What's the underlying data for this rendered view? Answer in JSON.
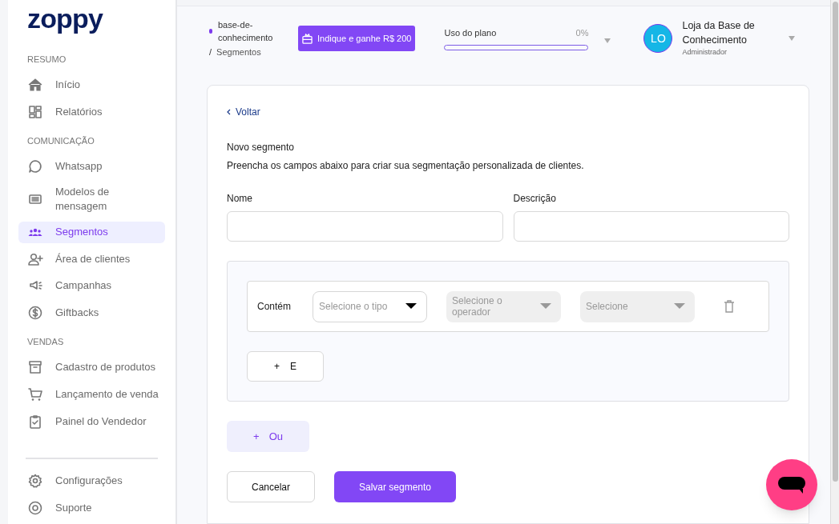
{
  "logo": "zoppy",
  "sidebar": {
    "sections": [
      {
        "title": "RESUMO",
        "items": [
          {
            "label": "Início",
            "kind": "home",
            "selected": false
          },
          {
            "label": "Relatórios",
            "kind": "grid",
            "selected": false
          }
        ]
      },
      {
        "title": "COMUNICAÇÃO",
        "items": [
          {
            "label": "Whatsapp",
            "kind": "chat",
            "selected": false
          },
          {
            "label": "Modelos de mensagem",
            "kind": "list",
            "selected": false
          },
          {
            "label": "Segmentos",
            "kind": "people",
            "selected": true
          },
          {
            "label": "Área de clientes",
            "kind": "user-plus",
            "selected": false
          },
          {
            "label": "Campanhas",
            "kind": "megaphone",
            "selected": false
          },
          {
            "label": "Giftbacks",
            "kind": "dollar",
            "selected": false
          }
        ]
      },
      {
        "title": "VENDAS",
        "items": [
          {
            "label": "Cadastro de produtos",
            "kind": "archive",
            "selected": false
          },
          {
            "label": "Lançamento de venda",
            "kind": "cart",
            "selected": false
          },
          {
            "label": "Painel do Vendedor",
            "kind": "clipboard",
            "selected": false
          }
        ]
      }
    ],
    "footer_items": [
      {
        "label": "Configurações",
        "kind": "gear",
        "selected": false
      },
      {
        "label": "Suporte",
        "kind": "help",
        "selected": false
      }
    ]
  },
  "header": {
    "breadcrumb": [
      "base-de-conhecimento",
      "Segmentos"
    ],
    "breadcrumb_separator": "/",
    "referral_button": "Indique e ganhe R$ 200",
    "plan": {
      "label": "Uso do plano",
      "reading": "0%",
      "level": 0
    },
    "user": {
      "initials": "LO",
      "name": "Loja da Base de Conhecimento",
      "role": "Administrador"
    }
  },
  "form": {
    "back": "Voltar",
    "title": "Novo segmento",
    "description": "Preencha os campos abaixo para criar sua segmentação personalizada de clientes.",
    "fields": [
      {
        "label": "Nome"
      },
      {
        "label": "Descrição"
      }
    ],
    "rule": {
      "label": "Contém",
      "selects": [
        {
          "placeholder": "Selecione o tipo",
          "disabled": false
        },
        {
          "placeholder": "Selecione o operador",
          "disabled": true
        },
        {
          "placeholder": "Selecione",
          "disabled": true
        }
      ]
    },
    "and_button": {
      "icon": "+",
      "label": "E"
    },
    "or_button": {
      "icon": "+",
      "label": "Ou"
    },
    "buttons": [
      {
        "label": "Cancelar",
        "kind": "secondary"
      },
      {
        "label": "Salvar segmento",
        "kind": "primary"
      }
    ]
  }
}
